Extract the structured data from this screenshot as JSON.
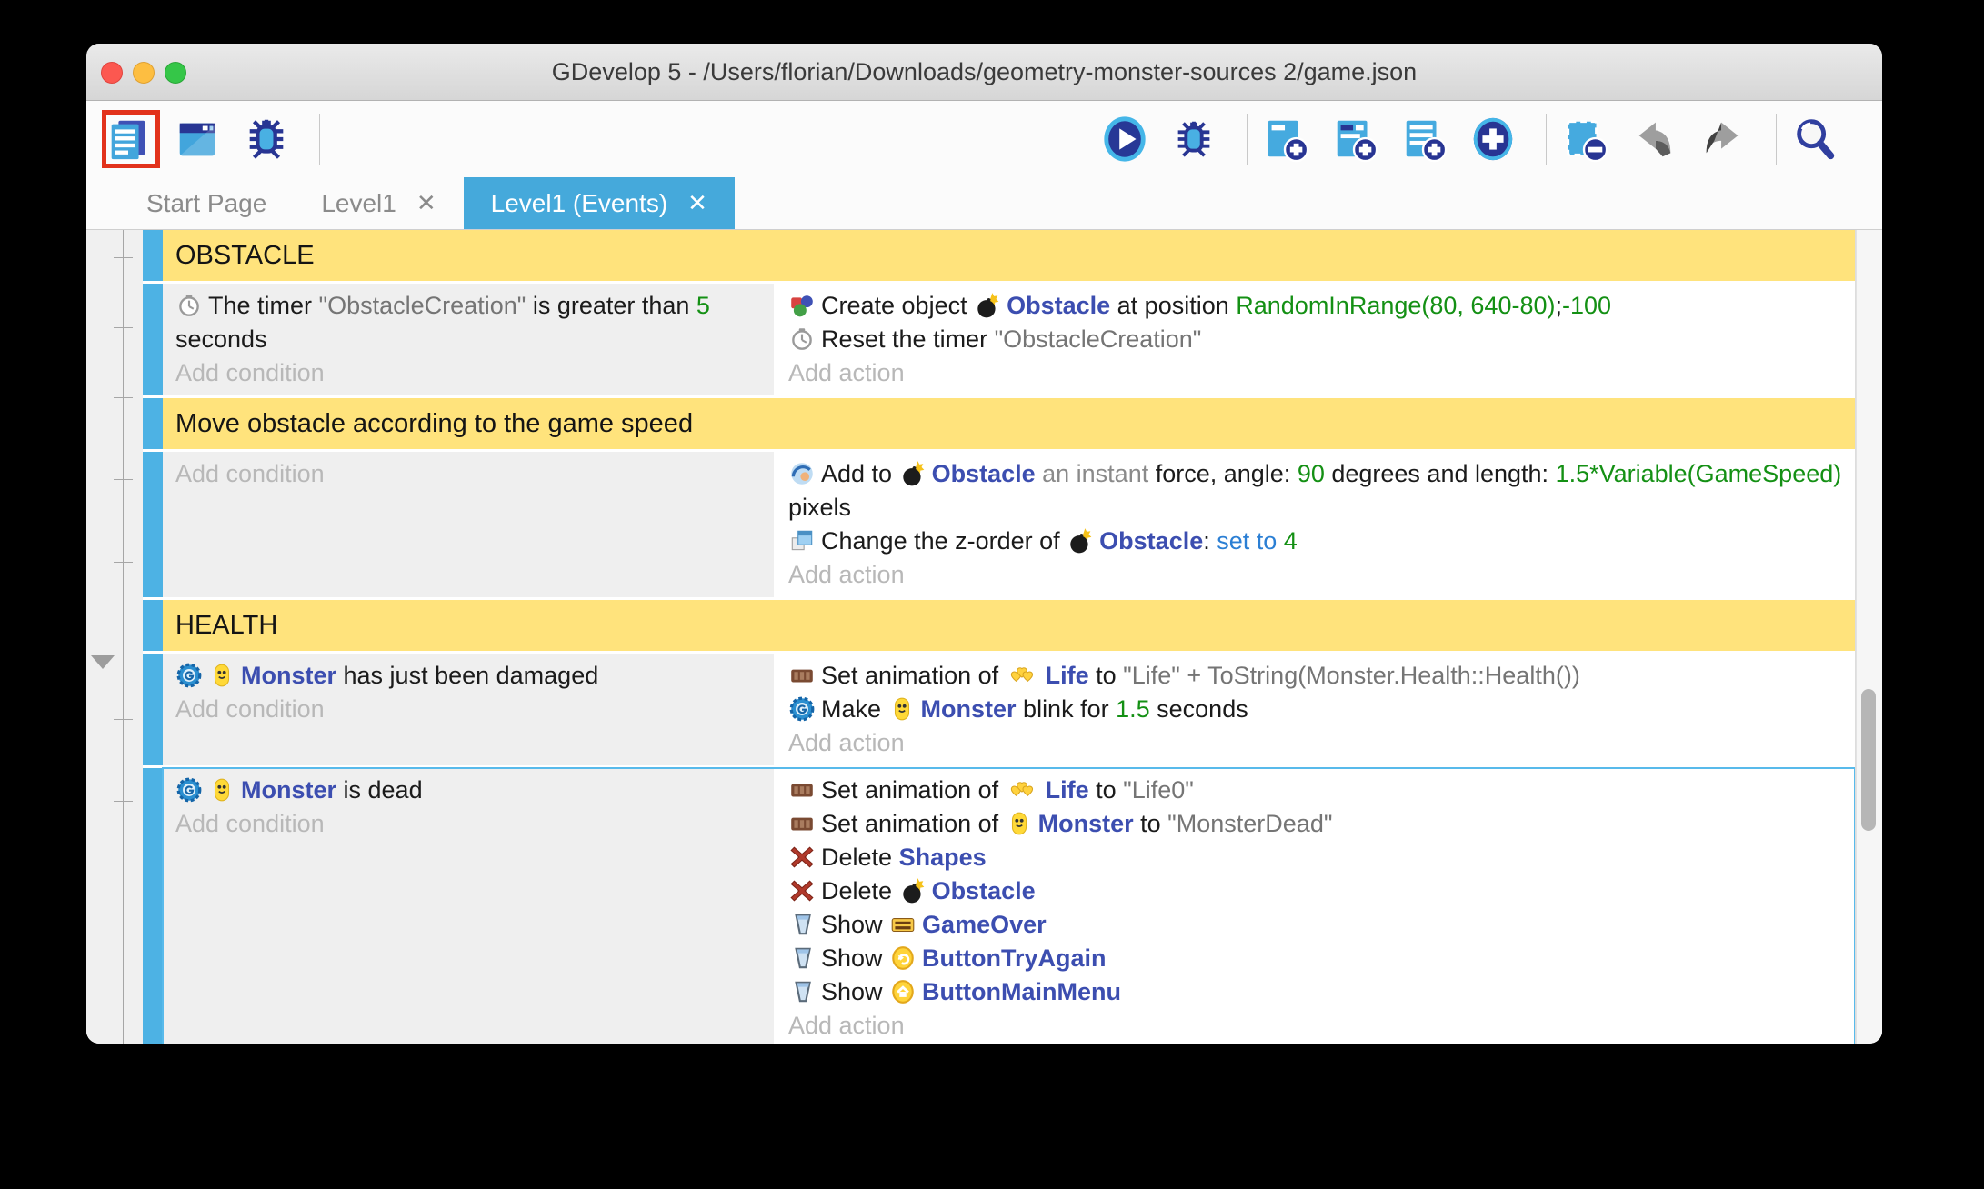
{
  "window": {
    "title": "GDevelop 5 - /Users/florian/Downloads/geometry-monster-sources 2/game.json",
    "traffic_lights": [
      "close",
      "minimize",
      "zoom"
    ]
  },
  "toolbar": {
    "left": [
      {
        "name": "project-manager-button",
        "icon": "project-manager-icon",
        "highlighted": true
      },
      {
        "name": "scene-editor-button",
        "icon": "scene-editor-icon"
      },
      {
        "name": "debugger-button",
        "icon": "debugger-icon"
      },
      {
        "divider": true
      }
    ],
    "right": [
      {
        "name": "preview-play-button",
        "icon": "play-icon"
      },
      {
        "name": "debug-preview-button",
        "icon": "debug-bug-icon"
      },
      {
        "divider": true
      },
      {
        "name": "add-event-button",
        "icon": "add-event-icon"
      },
      {
        "name": "add-subevent-button",
        "icon": "add-subevent-icon"
      },
      {
        "name": "add-comment-button",
        "icon": "add-comment-icon"
      },
      {
        "name": "add-other-event-button",
        "icon": "add-plus-icon"
      },
      {
        "divider": true
      },
      {
        "name": "delete-event-button",
        "icon": "delete-event-icon"
      },
      {
        "name": "undo-button",
        "icon": "undo-icon"
      },
      {
        "name": "redo-button",
        "icon": "redo-icon"
      },
      {
        "divider": true
      },
      {
        "name": "search-button",
        "icon": "search-icon"
      }
    ]
  },
  "tabs": [
    {
      "label": "Start Page",
      "active": false,
      "closable": false
    },
    {
      "label": "Level1",
      "active": false,
      "closable": true
    },
    {
      "label": "Level1 (Events)",
      "active": true,
      "closable": true
    }
  ],
  "events": [
    {
      "type": "group",
      "label": "OBSTACLE"
    },
    {
      "type": "event",
      "selected": false,
      "conditions": [
        [
          {
            "i": "timer-icon"
          },
          {
            "t": "The timer ",
            "s": "plain"
          },
          {
            "t": "\"ObstacleCreation\"",
            "s": "string"
          },
          {
            "t": " is greater than ",
            "s": "plain"
          },
          {
            "t": "5",
            "s": "expr"
          },
          {
            "t": " seconds",
            "s": "plain"
          }
        ]
      ],
      "add_condition": "Add condition",
      "actions": [
        [
          {
            "i": "create-object-icon"
          },
          {
            "t": "Create object ",
            "s": "plain"
          },
          {
            "i": "bomb-icon"
          },
          {
            "t": "Obstacle",
            "s": "object"
          },
          {
            "t": " at position ",
            "s": "plain"
          },
          {
            "t": "RandomInRange(80, 640-80)",
            "s": "expr"
          },
          {
            "t": ";",
            "s": "plain"
          },
          {
            "t": "-100",
            "s": "expr"
          }
        ],
        [
          {
            "i": "timer-icon"
          },
          {
            "t": "Reset the timer ",
            "s": "plain"
          },
          {
            "t": "\"ObstacleCreation\"",
            "s": "string"
          }
        ]
      ],
      "add_action": "Add action"
    },
    {
      "type": "group",
      "label": "Move obstacle according to the game speed"
    },
    {
      "type": "event",
      "selected": false,
      "conditions": [],
      "add_condition": "Add condition",
      "actions": [
        [
          {
            "i": "force-icon"
          },
          {
            "t": "Add to ",
            "s": "plain"
          },
          {
            "i": "bomb-icon"
          },
          {
            "t": "Obstacle",
            "s": "object"
          },
          {
            "t": " an instant ",
            "s": "opt"
          },
          {
            "t": "force, angle: ",
            "s": "plain"
          },
          {
            "t": "90",
            "s": "expr"
          },
          {
            "t": " degrees and length: ",
            "s": "plain"
          },
          {
            "t": "1.5*Variable(GameSpeed)",
            "s": "expr"
          },
          {
            "t": " pixels",
            "s": "plain"
          }
        ],
        [
          {
            "i": "zorder-icon"
          },
          {
            "t": "Change the z-order of ",
            "s": "plain"
          },
          {
            "i": "bomb-icon"
          },
          {
            "t": "Obstacle",
            "s": "object"
          },
          {
            "t": ": ",
            "s": "plain"
          },
          {
            "t": "set to ",
            "s": "setto"
          },
          {
            "t": "4",
            "s": "expr"
          }
        ]
      ],
      "add_action": "Add action"
    },
    {
      "type": "group",
      "label": "HEALTH"
    },
    {
      "type": "event",
      "selected": false,
      "conditions": [
        [
          {
            "i": "gdevelop-badge-icon"
          },
          {
            "i": "monster-icon"
          },
          {
            "t": "Monster",
            "s": "object"
          },
          {
            "t": " has just been damaged",
            "s": "plain"
          }
        ]
      ],
      "add_condition": "Add condition",
      "actions": [
        [
          {
            "i": "animation-icon"
          },
          {
            "t": "Set animation of ",
            "s": "plain"
          },
          {
            "i": "hearts-icon"
          },
          {
            "t": "Life",
            "s": "object"
          },
          {
            "t": " to ",
            "s": "plain"
          },
          {
            "t": "\"Life\" + ToString(Monster.Health::Health())",
            "s": "string"
          }
        ],
        [
          {
            "i": "gdevelop-badge-icon"
          },
          {
            "t": "Make ",
            "s": "plain"
          },
          {
            "i": "monster-icon"
          },
          {
            "t": "Monster",
            "s": "object"
          },
          {
            "t": " blink for ",
            "s": "plain"
          },
          {
            "t": "1.5",
            "s": "expr"
          },
          {
            "t": " seconds",
            "s": "plain"
          }
        ]
      ],
      "add_action": "Add action"
    },
    {
      "type": "event",
      "selected": true,
      "conditions": [
        [
          {
            "i": "gdevelop-badge-icon"
          },
          {
            "i": "monster-icon"
          },
          {
            "t": "Monster",
            "s": "object"
          },
          {
            "t": " is dead",
            "s": "plain"
          }
        ]
      ],
      "add_condition": "Add condition",
      "actions": [
        [
          {
            "i": "animation-icon"
          },
          {
            "t": "Set animation of ",
            "s": "plain"
          },
          {
            "i": "hearts-icon"
          },
          {
            "t": "Life",
            "s": "object"
          },
          {
            "t": " to ",
            "s": "plain"
          },
          {
            "t": "\"Life0\"",
            "s": "string"
          }
        ],
        [
          {
            "i": "animation-icon"
          },
          {
            "t": "Set animation of ",
            "s": "plain"
          },
          {
            "i": "monster-icon"
          },
          {
            "t": "Monster",
            "s": "object"
          },
          {
            "t": " to ",
            "s": "plain"
          },
          {
            "t": "\"MonsterDead\"",
            "s": "string"
          }
        ],
        [
          {
            "i": "delete-icon"
          },
          {
            "t": "Delete ",
            "s": "plain"
          },
          {
            "t": "Shapes",
            "s": "object"
          }
        ],
        [
          {
            "i": "delete-icon"
          },
          {
            "t": "Delete ",
            "s": "plain"
          },
          {
            "i": "bomb-icon"
          },
          {
            "t": "Obstacle",
            "s": "object"
          }
        ],
        [
          {
            "i": "show-icon"
          },
          {
            "t": "Show ",
            "s": "plain"
          },
          {
            "i": "gameover-icon"
          },
          {
            "t": "GameOver",
            "s": "object"
          }
        ],
        [
          {
            "i": "show-icon"
          },
          {
            "t": "Show ",
            "s": "plain"
          },
          {
            "i": "tryagain-icon"
          },
          {
            "t": "ButtonTryAgain",
            "s": "object"
          }
        ],
        [
          {
            "i": "show-icon"
          },
          {
            "t": "Show ",
            "s": "plain"
          },
          {
            "i": "mainmenu-icon"
          },
          {
            "t": "ButtonMainMenu",
            "s": "object"
          }
        ]
      ],
      "add_action": "Add action"
    }
  ]
}
